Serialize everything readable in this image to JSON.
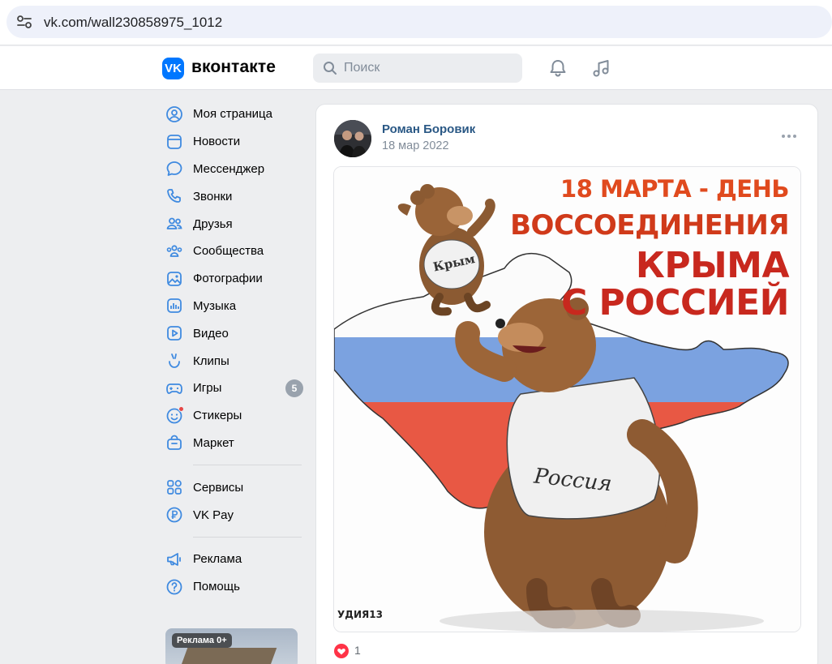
{
  "browser": {
    "url": "vk.com/wall230858975_1012",
    "site_icon": "site-settings-icon"
  },
  "header": {
    "logo_letter": "VK",
    "wordmark": "вконтакте",
    "search_placeholder": "Поиск",
    "notifications_icon": "bell-icon",
    "music_icon": "music-note-icon"
  },
  "sidebar": {
    "items": [
      {
        "label": "Моя страница",
        "icon": "user-circle-icon"
      },
      {
        "label": "Новости",
        "icon": "news-feed-icon"
      },
      {
        "label": "Мессенджер",
        "icon": "message-bubble-icon"
      },
      {
        "label": "Звонки",
        "icon": "phone-icon"
      },
      {
        "label": "Друзья",
        "icon": "friends-icon"
      },
      {
        "label": "Сообщества",
        "icon": "communities-icon"
      },
      {
        "label": "Фотографии",
        "icon": "photo-icon"
      },
      {
        "label": "Музыка",
        "icon": "music-icon"
      },
      {
        "label": "Видео",
        "icon": "video-icon"
      },
      {
        "label": "Клипы",
        "icon": "clips-icon"
      },
      {
        "label": "Игры",
        "icon": "gamepad-icon",
        "badge": "5"
      },
      {
        "label": "Стикеры",
        "icon": "sticker-icon"
      },
      {
        "label": "Маркет",
        "icon": "market-bag-icon"
      }
    ],
    "items2": [
      {
        "label": "Сервисы",
        "icon": "services-grid-icon"
      },
      {
        "label": "VK Pay",
        "icon": "vk-pay-icon"
      }
    ],
    "items3": [
      {
        "label": "Реклама",
        "icon": "megaphone-icon"
      },
      {
        "label": "Помощь",
        "icon": "help-icon"
      }
    ],
    "ad_label": "Реклама 0+"
  },
  "post": {
    "author": "Роман Боровик",
    "date": "18 мар 2022",
    "likes": "1",
    "image": {
      "line1": "18 МАРТА - ДЕНЬ",
      "line2": "ВОССОЕДИНЕНИЯ",
      "line3": "КРЫМА",
      "line4": "С РОССИЕЙ",
      "small_bear_shirt": "Крым",
      "big_bear_shirt": "Россия",
      "signature": "УДИЯ13"
    }
  },
  "colors": {
    "vk_blue": "#0077ff",
    "link": "#2a5885",
    "background": "#edeef0",
    "like_red": "#e64646"
  }
}
